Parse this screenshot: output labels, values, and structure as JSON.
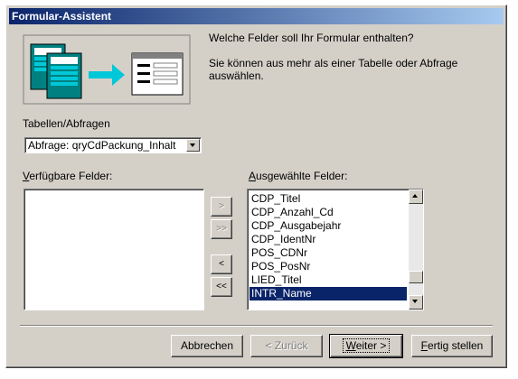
{
  "window": {
    "title": "Formular-Assistent"
  },
  "intro": {
    "question": "Welche Felder soll Ihr Formular enthalten?",
    "hint": "Sie können aus mehr als einer Tabelle oder Abfrage auswählen."
  },
  "source": {
    "label": "Tabellen/Abfragen",
    "selected": "Abfrage: qryCdPackung_Inhalt"
  },
  "available": {
    "label_underline": "V",
    "label_rest": "erfügbare Felder:",
    "items": []
  },
  "selected_fields": {
    "label_underline": "A",
    "label_rest": "usgewählte Felder:",
    "items": [
      "CDP_Titel",
      "CDP_Anzahl_Cd",
      "CDP_Ausgabejahr",
      "CDP_IdentNr",
      "POS_CDNr",
      "POS_PosNr",
      "LIED_Titel",
      "INTR_Name"
    ],
    "selected_item": "INTR_Name"
  },
  "move_buttons": {
    "add_one": ">",
    "add_all": ">>",
    "remove_one": "<",
    "remove_all": "<<"
  },
  "footer": {
    "cancel": "Abbrechen",
    "back": "< Zurück",
    "next_underline": "W",
    "next_rest": "eiter >",
    "finish_underline": "F",
    "finish_rest": "ertig stellen"
  },
  "colors": {
    "title_start": "#0a246a",
    "title_end": "#a6caf0",
    "selection": "#0a246a",
    "dialog_face": "#d4d0c8",
    "illustration_accent": "#00c8d8"
  },
  "icons": [
    "table-stack-icon",
    "arrow-right-icon",
    "form-icon",
    "chevron-down-icon",
    "chevron-up-icon"
  ]
}
